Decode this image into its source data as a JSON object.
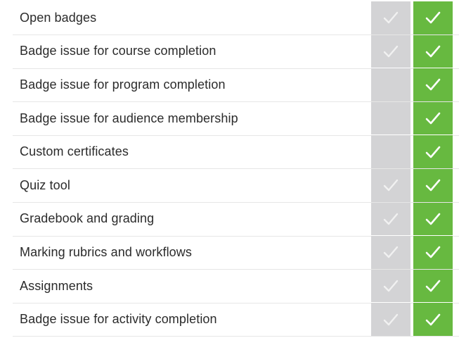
{
  "colors": {
    "basic_column": "#d3d3d5",
    "premium_column": "#67b940",
    "text": "#2b2b2b"
  },
  "rows": [
    {
      "label": "Open badges",
      "basic": true,
      "premium": true
    },
    {
      "label": "Badge issue for course completion",
      "basic": true,
      "premium": true
    },
    {
      "label": "Badge issue for program completion",
      "basic": false,
      "premium": true
    },
    {
      "label": "Badge issue for audience membership",
      "basic": false,
      "premium": true
    },
    {
      "label": "Custom certificates",
      "basic": false,
      "premium": true
    },
    {
      "label": "Quiz tool",
      "basic": true,
      "premium": true
    },
    {
      "label": "Gradebook and grading",
      "basic": true,
      "premium": true
    },
    {
      "label": "Marking rubrics and workflows",
      "basic": true,
      "premium": true
    },
    {
      "label": "Assignments",
      "basic": true,
      "premium": true
    },
    {
      "label": "Badge issue for activity completion",
      "basic": true,
      "premium": true
    }
  ],
  "icons": {
    "check": "checkmark-icon"
  }
}
